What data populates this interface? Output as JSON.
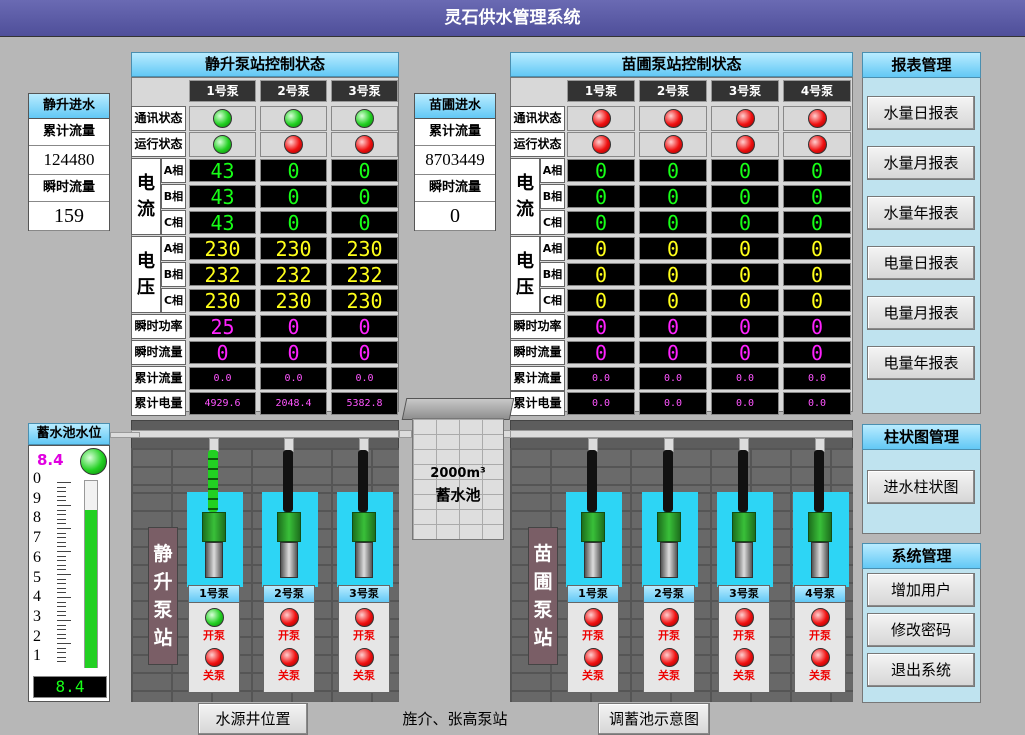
{
  "app_title": "灵石供水管理系统",
  "left_station": {
    "title": "静升泵站控制状态",
    "pumps": [
      "1号泵",
      "2号泵",
      "3号泵"
    ],
    "row_labels": {
      "comm": "通讯状态",
      "run": "运行状态",
      "phase_a": "A相",
      "phase_b": "B相",
      "phase_c": "C相",
      "power": "瞬时功率",
      "flow": "瞬时流量",
      "total_flow": "累计流量",
      "total_elec": "累计电量"
    },
    "current_label": [
      "电",
      "流"
    ],
    "voltage_label": [
      "电",
      "压"
    ],
    "comm_status": [
      "green",
      "green",
      "green"
    ],
    "run_status": [
      "green",
      "red",
      "red"
    ],
    "current": {
      "a": [
        "43",
        "0",
        "0"
      ],
      "b": [
        "43",
        "0",
        "0"
      ],
      "c": [
        "43",
        "0",
        "0"
      ]
    },
    "voltage": {
      "a": [
        "230",
        "230",
        "230"
      ],
      "b": [
        "232",
        "232",
        "232"
      ],
      "c": [
        "230",
        "230",
        "230"
      ]
    },
    "power": [
      "25",
      "0",
      "0"
    ],
    "flow": [
      "0",
      "0",
      "0"
    ],
    "total_flow": [
      "0.0",
      "0.0",
      "0.0"
    ],
    "total_elec": [
      "4929.6",
      "2048.4",
      "5382.8"
    ]
  },
  "right_station": {
    "title": "苗圃泵站控制状态",
    "pumps": [
      "1号泵",
      "2号泵",
      "3号泵",
      "4号泵"
    ],
    "row_labels": {
      "comm": "通讯状态",
      "run": "运行状态",
      "phase_a": "A相",
      "phase_b": "B相",
      "phase_c": "C相",
      "power": "瞬时功率",
      "flow": "瞬时流量",
      "total_flow": "累计流量",
      "total_elec": "累计电量"
    },
    "current_label": [
      "电",
      "流"
    ],
    "voltage_label": [
      "电",
      "压"
    ],
    "comm_status": [
      "red",
      "red",
      "red",
      "red"
    ],
    "run_status": [
      "red",
      "red",
      "red",
      "red"
    ],
    "current": {
      "a": [
        "0",
        "0",
        "0",
        "0"
      ],
      "b": [
        "0",
        "0",
        "0",
        "0"
      ],
      "c": [
        "0",
        "0",
        "0",
        "0"
      ]
    },
    "voltage": {
      "a": [
        "0",
        "0",
        "0",
        "0"
      ],
      "b": [
        "0",
        "0",
        "0",
        "0"
      ],
      "c": [
        "0",
        "0",
        "0",
        "0"
      ]
    },
    "power": [
      "0",
      "0",
      "0",
      "0"
    ],
    "flow": [
      "0",
      "0",
      "0",
      "0"
    ],
    "total_flow": [
      "0.0",
      "0.0",
      "0.0",
      "0.0"
    ],
    "total_elec": [
      "0.0",
      "0.0",
      "0.0",
      "0.0"
    ]
  },
  "left_inflow": {
    "title": "静升进水",
    "total_label": "累计流量",
    "total_value": "124480",
    "instant_label": "瞬时流量",
    "instant_value": "159"
  },
  "right_inflow": {
    "title": "苗圃进水",
    "total_label": "累计流量",
    "total_value": "8703449",
    "instant_label": "瞬时流量",
    "instant_value": "0"
  },
  "reservoir_level": {
    "title": "蓄水池水位",
    "value": "8.4",
    "display": "8.4",
    "scale": [
      "0",
      "9",
      "8",
      "7",
      "6",
      "5",
      "4",
      "3",
      "2",
      "1"
    ],
    "fill_fraction": 0.84
  },
  "reservoir": {
    "capacity": "2000m³",
    "name": "蓄水池"
  },
  "left_scene": {
    "label": [
      "静",
      "升",
      "泵",
      "站"
    ],
    "pumps": [
      {
        "name": "1号泵",
        "start": "开泵",
        "stop": "关泵",
        "running": true
      },
      {
        "name": "2号泵",
        "start": "开泵",
        "stop": "关泵",
        "running": false
      },
      {
        "name": "3号泵",
        "start": "开泵",
        "stop": "关泵",
        "running": false
      }
    ]
  },
  "right_scene": {
    "label": [
      "苗",
      "圃",
      "泵",
      "站"
    ],
    "pumps": [
      {
        "name": "1号泵",
        "start": "开泵",
        "stop": "关泵",
        "running": false
      },
      {
        "name": "2号泵",
        "start": "开泵",
        "stop": "关泵",
        "running": false
      },
      {
        "name": "3号泵",
        "start": "开泵",
        "stop": "关泵",
        "running": false
      },
      {
        "name": "4号泵",
        "start": "开泵",
        "stop": "关泵",
        "running": false
      }
    ]
  },
  "report_panel": {
    "title": "报表管理",
    "buttons": [
      "水量日报表",
      "水量月报表",
      "水量年报表",
      "电量日报表",
      "电量月报表",
      "电量年报表"
    ]
  },
  "bar_panel": {
    "title": "柱状图管理",
    "buttons": [
      "进水柱状图"
    ]
  },
  "system_panel": {
    "title": "系统管理",
    "buttons": [
      "增加用户",
      "修改密码",
      "退出系统"
    ]
  },
  "bottom_nav": {
    "well_location": "水源井位置",
    "station_link": "旌介、张高泵站",
    "reservoir_diagram": "调蓄池示意图"
  },
  "colors": {
    "led_green": "#22d022",
    "led_red": "#f01010",
    "lcd_bg": "#000000",
    "water": "#2dd5f5"
  }
}
